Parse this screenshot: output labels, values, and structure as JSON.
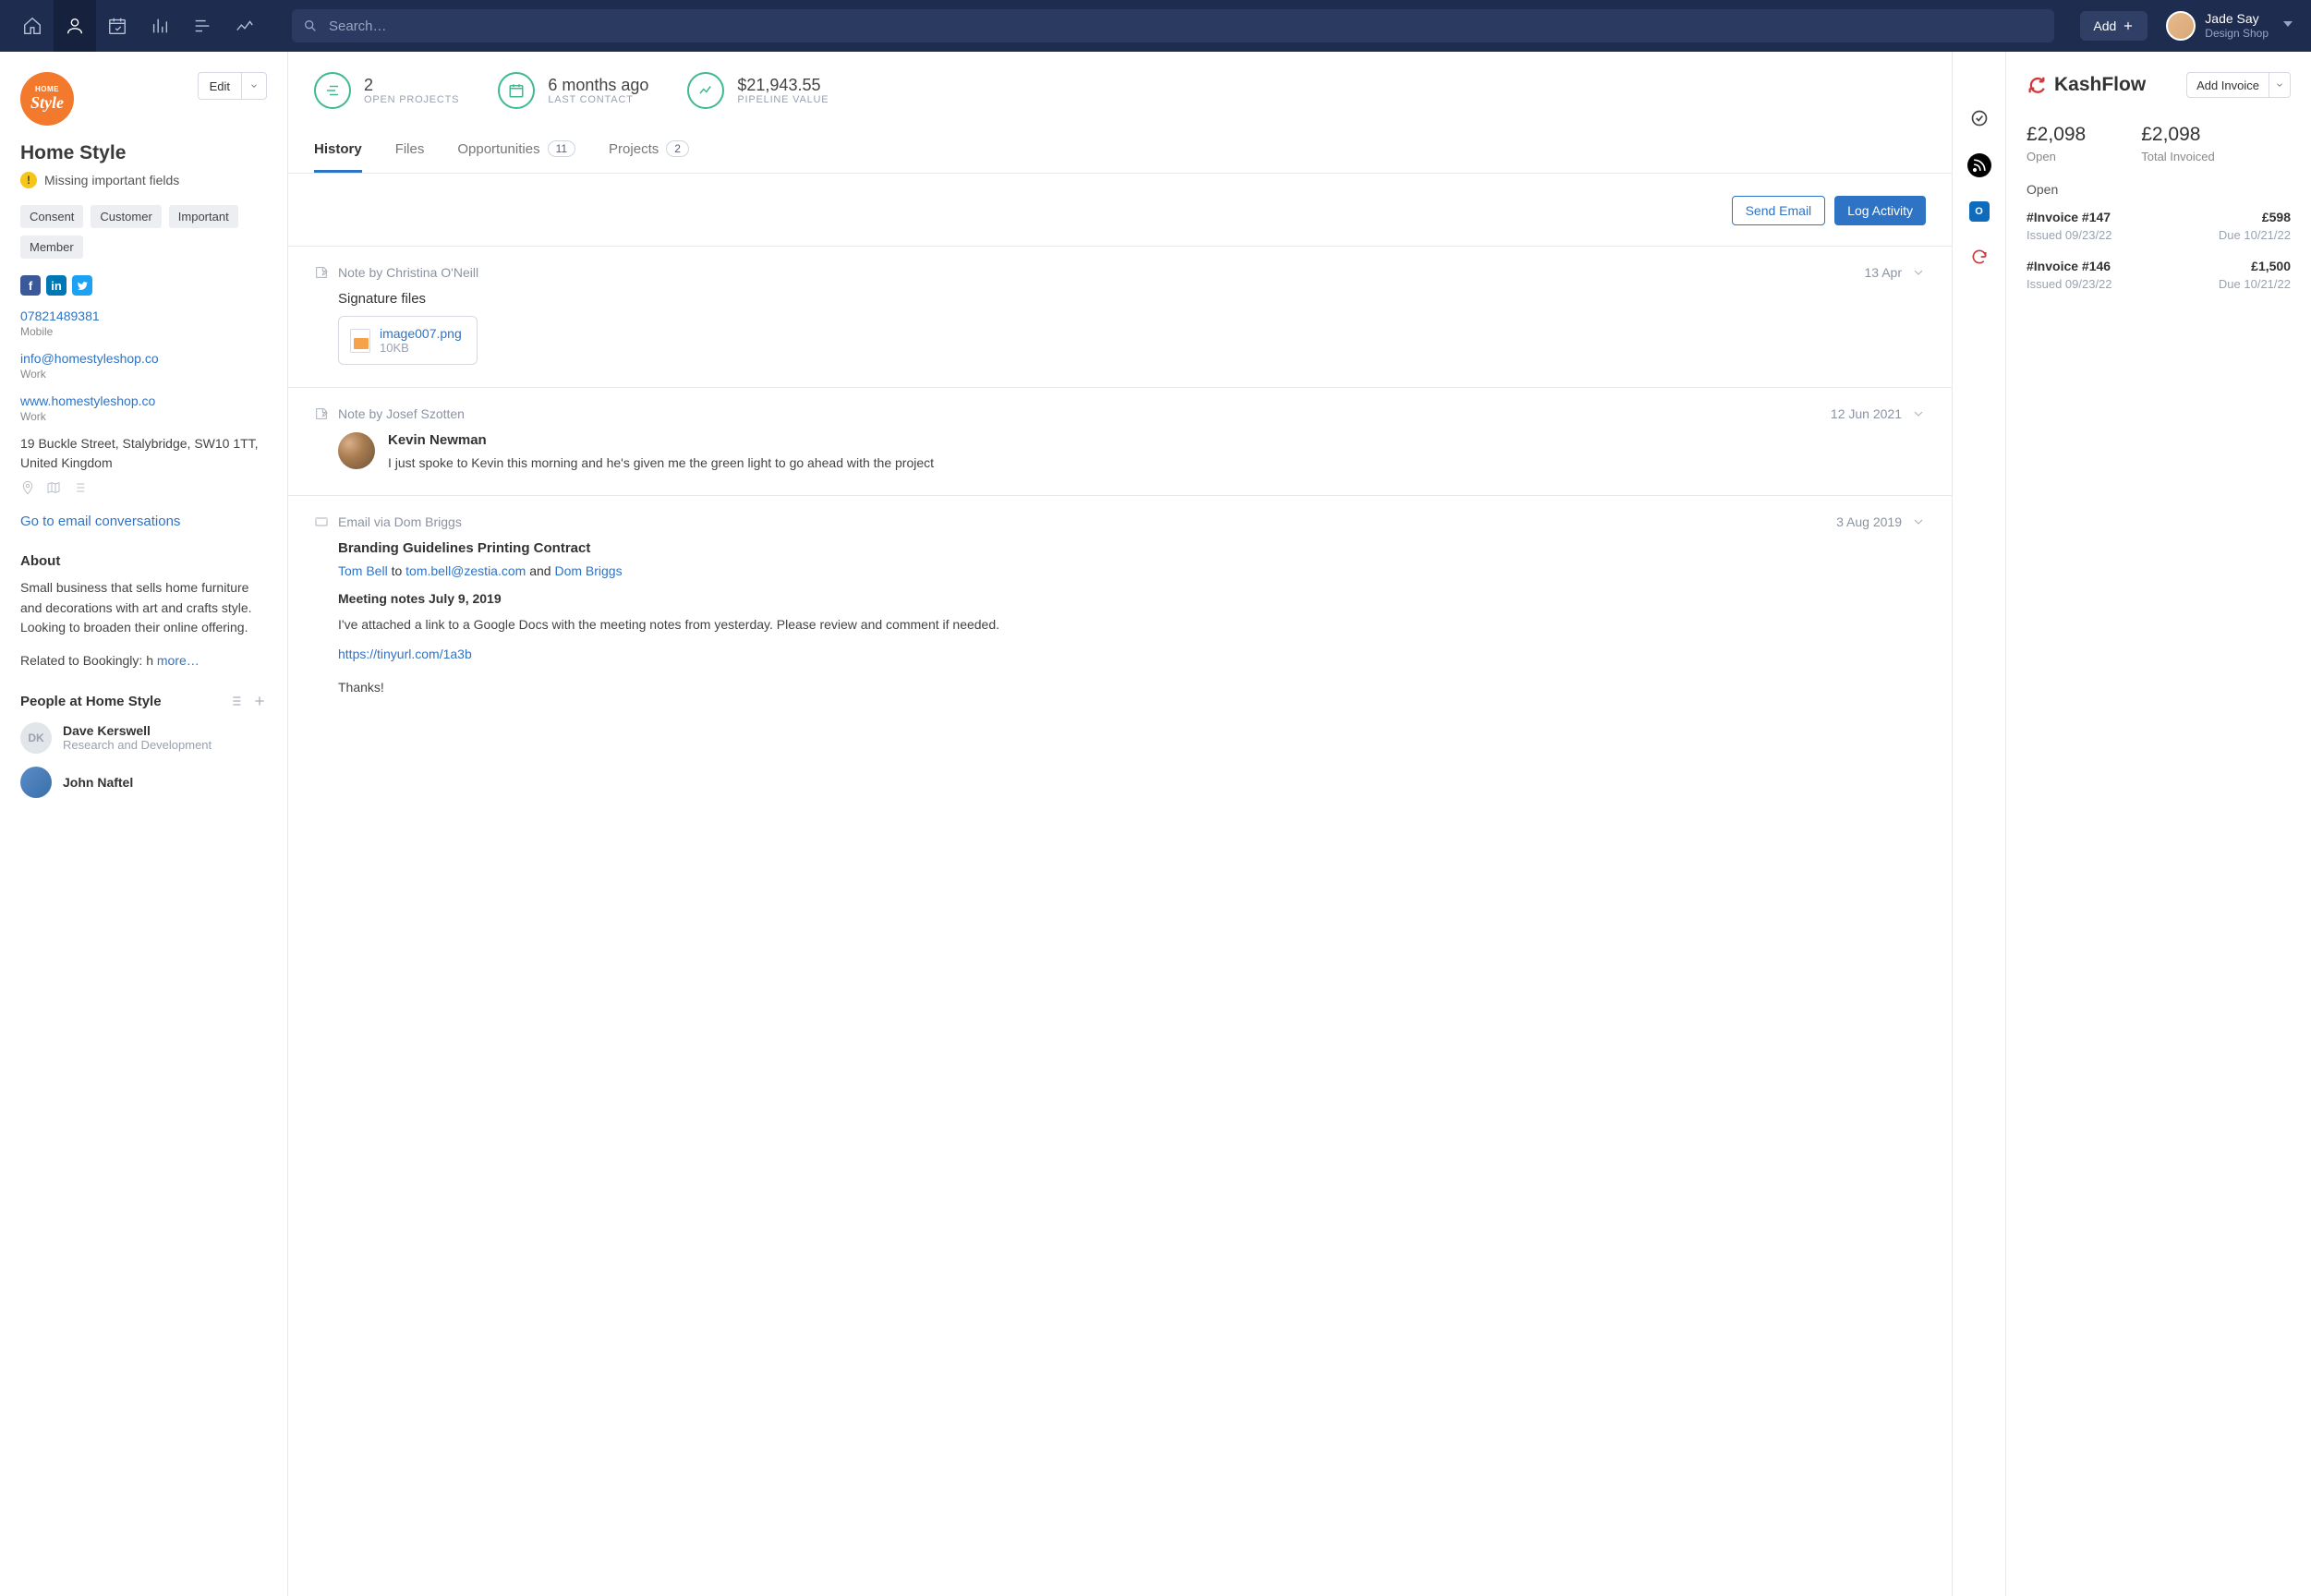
{
  "topbar": {
    "search_placeholder": "Search…",
    "add_label": "Add",
    "user": {
      "name": "Jade Say",
      "sub": "Design Shop"
    }
  },
  "left": {
    "edit_label": "Edit",
    "company_name": "Home Style",
    "logo_line1": "HOME",
    "logo_line2": "Style",
    "missing_msg": "Missing important fields",
    "tags": [
      "Consent",
      "Customer",
      "Important",
      "Member"
    ],
    "phone": "07821489381",
    "phone_label": "Mobile",
    "email": "info@homestyleshop.co",
    "email_label": "Work",
    "website": "www.homestyleshop.co",
    "website_label": "Work",
    "address": "19 Buckle Street, Stalybridge, SW10 1TT, United Kingdom",
    "goto_convo": "Go to email conversations",
    "about_h": "About",
    "about_text": "Small business that sells home furniture and decorations with art and crafts style. Looking to broaden their online offering.",
    "about_extra": "Related to Bookingly: h ",
    "more": "more…",
    "people_h": "People at Home Style",
    "people": [
      {
        "initials": "DK",
        "name": "Dave Kerswell",
        "role": "Research and Development"
      },
      {
        "initials": "",
        "name": "John Naftel",
        "role": ""
      }
    ]
  },
  "mid": {
    "stats": [
      {
        "value": "2",
        "label": "OPEN PROJECTS"
      },
      {
        "value": "6 months ago",
        "label": "LAST CONTACT"
      },
      {
        "value": "$21,943.55",
        "label": "PIPELINE VALUE"
      }
    ],
    "tabs": {
      "history": "History",
      "files": "Files",
      "opportunities": "Opportunities",
      "opportunities_badge": "11",
      "projects": "Projects",
      "projects_badge": "2"
    },
    "actions": {
      "send_email": "Send Email",
      "log_activity": "Log Activity"
    },
    "entry1": {
      "who": "Note by Christina O'Neill",
      "date": "13 Apr",
      "title": "Signature files",
      "file_name": "image007.png",
      "file_size": "10KB"
    },
    "entry2": {
      "who": "Note by Josef Szotten",
      "date": "12 Jun 2021",
      "profile_name": "Kevin Newman",
      "text": "I just spoke to Kevin this morning and he's given me the green light to go ahead with the project"
    },
    "entry3": {
      "who": "Email via Dom Briggs",
      "date": "3 Aug 2019",
      "subject": "Branding Guidelines Printing Contract",
      "from": "Tom Bell",
      "to_word": " to ",
      "to_email": "tom.bell@zestia.com",
      "and_word": " and ",
      "cc": "Dom Briggs",
      "h2": "Meeting notes July 9, 2019",
      "para": "I've attached a link to a Google Docs with the meeting notes from yesterday. Please review and comment if needed.",
      "link": "https://tinyurl.com/1a3b",
      "thanks": "Thanks!"
    }
  },
  "right": {
    "title": "KashFlow",
    "add_invoice": "Add Invoice",
    "stat_open_amt": "£2,098",
    "stat_open_lbl": "Open",
    "stat_total_amt": "£2,098",
    "stat_total_lbl": "Total Invoiced",
    "open_h": "Open",
    "invoices": [
      {
        "name": "#Invoice #147",
        "amt": "£598",
        "issued": "Issued 09/23/22",
        "due": "Due 10/21/22"
      },
      {
        "name": "#Invoice #146",
        "amt": "£1,500",
        "issued": "Issued 09/23/22",
        "due": "Due 10/21/22"
      }
    ]
  }
}
